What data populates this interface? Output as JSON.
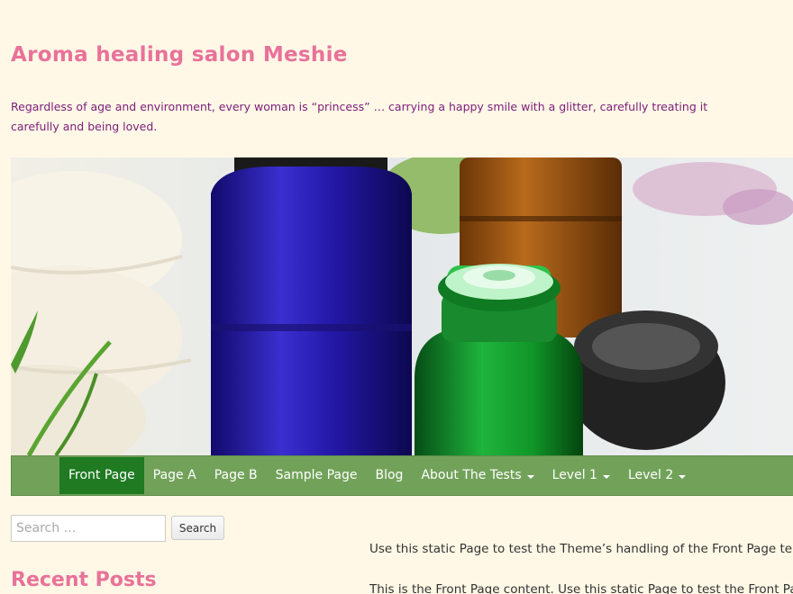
{
  "site": {
    "title": "Aroma healing salon Meshie",
    "description": "Regardless of age and environment, every woman is “princess” … carrying a happy smile with a glitter, carefully treating it carefully and being loved."
  },
  "nav": {
    "items": [
      {
        "label": "Front Page",
        "active": true,
        "dropdown": false
      },
      {
        "label": "Page A",
        "active": false,
        "dropdown": false
      },
      {
        "label": "Page B",
        "active": false,
        "dropdown": false
      },
      {
        "label": "Sample Page",
        "active": false,
        "dropdown": false
      },
      {
        "label": "Blog",
        "active": false,
        "dropdown": false
      },
      {
        "label": "About The Tests",
        "active": false,
        "dropdown": true
      },
      {
        "label": "Level 1",
        "active": false,
        "dropdown": true
      },
      {
        "label": "Level 2",
        "active": false,
        "dropdown": true
      }
    ]
  },
  "sidebar": {
    "search_placeholder": "Search …",
    "search_button": "Search",
    "recent_posts_title": "Recent Posts"
  },
  "content": {
    "paragraph1": "Use this static Page to test the Theme’s handling of the Front Page temp",
    "paragraph2": "This is the Front Page content. Use this static Page to test the Front Pag"
  },
  "colors": {
    "background": "#fff8e6",
    "title": "#e8729a",
    "description": "#7a1d7a",
    "nav": "#72a25a",
    "nav_active": "#1f7a22"
  }
}
